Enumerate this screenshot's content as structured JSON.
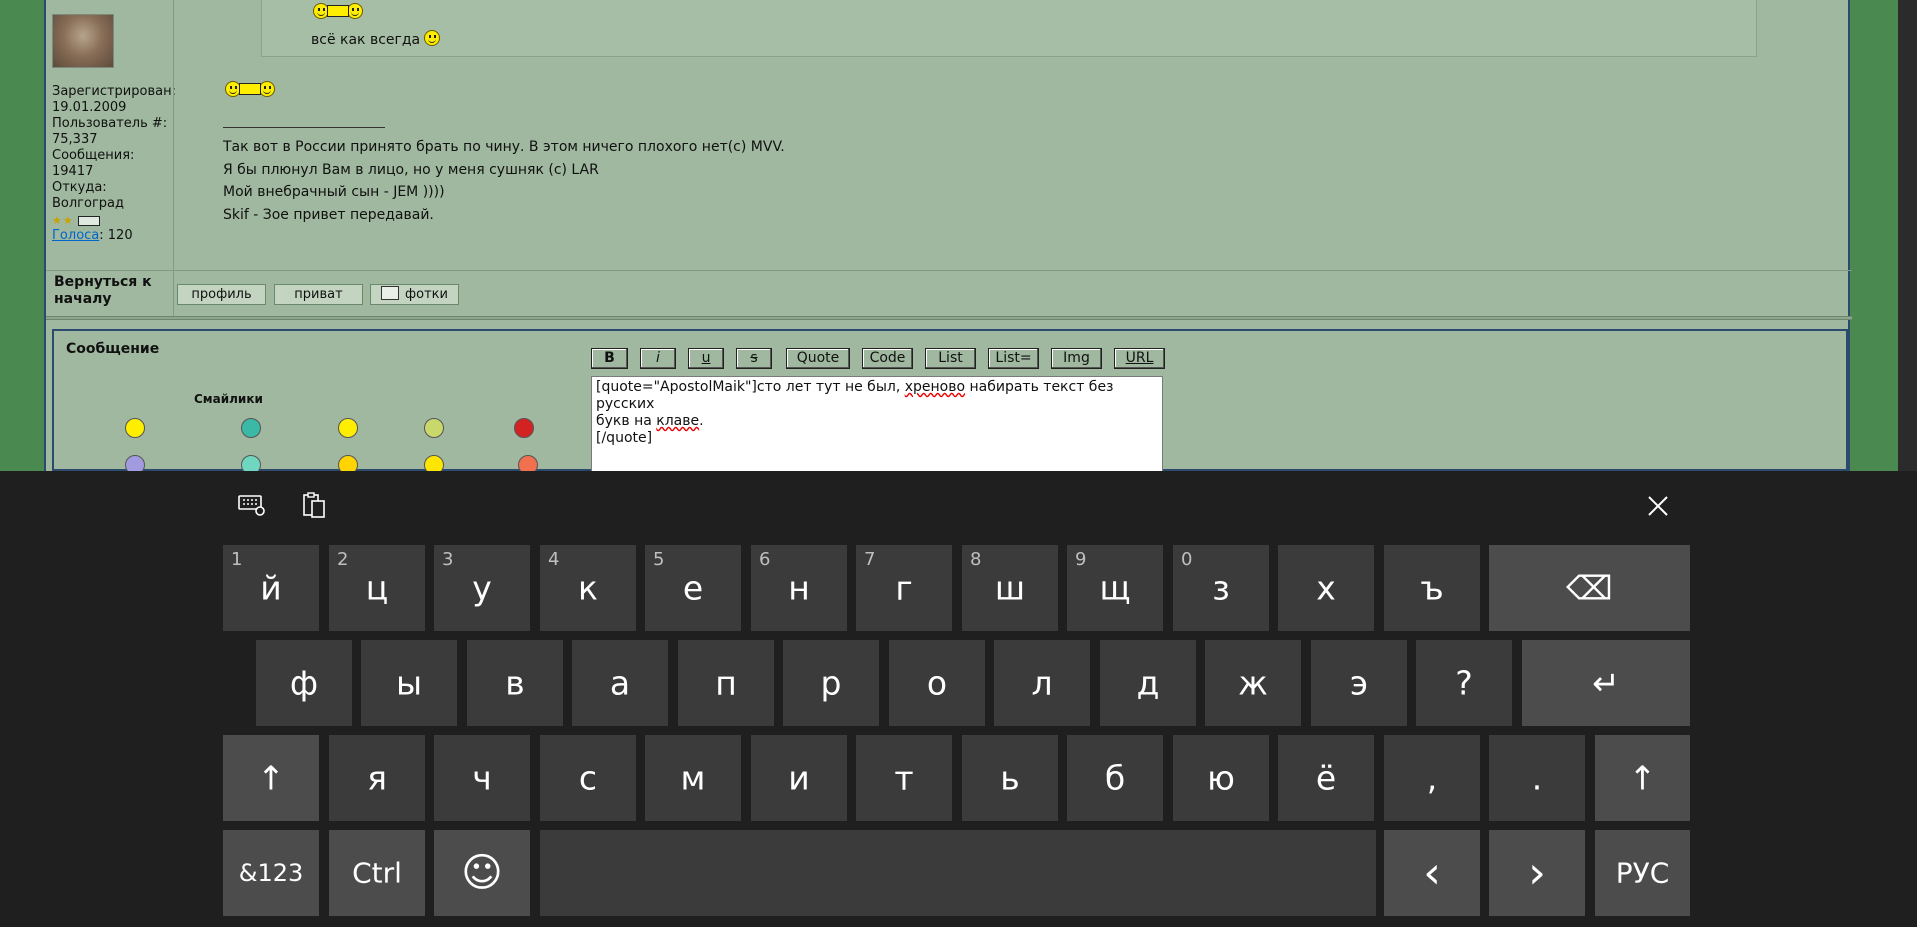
{
  "post": {
    "quote_text": "всё как всегда",
    "user": {
      "registered_label": "Зарегистрирован:",
      "registered_value": "19.01.2009",
      "user_no_label": "Пользователь #:",
      "user_no_value": "75,337",
      "messages_label": "Сообщения:",
      "messages_value": "19417",
      "from_label": "Откуда:",
      "from_value": "Волгоград",
      "votes_link": "Голоса",
      "votes_value": ": 120"
    },
    "signature": [
      "Так вот в России принято брать по чину. В этом ничего плохого нет(с) MVV.",
      "Я бы плюнул Вам в лицо, но у меня сушняк (с) LAR",
      "Мой внебрачный сын - JEM ))))",
      "Skif - Зое привет передавай."
    ],
    "back_to_top": "Вернуться к началу",
    "buttons": {
      "profile": "профиль",
      "private": "приват",
      "photos": "фотки"
    }
  },
  "editor": {
    "title": "Сообщение",
    "smilies_header": "Смайлики",
    "format_buttons": [
      "B",
      "i",
      "u",
      "s",
      "Quote",
      "Code",
      "List",
      "List=",
      "Img",
      "URL"
    ],
    "text_line1": "[quote=\"ApostolMaik\"]сто лет тут не был, ",
    "text_err1": "хреново",
    "text_line1b": " набирать текст без русских",
    "text_line2a": "букв на ",
    "text_err2": "клаве",
    "text_line2b": ".",
    "text_line3": "[/quote]"
  },
  "keyboard": {
    "toolbar": {
      "settings_icon": "keyboard-settings-icon",
      "clipboard_icon": "clipboard-icon",
      "close_icon": "close-icon"
    },
    "row1": [
      {
        "k": "й",
        "n": "1"
      },
      {
        "k": "ц",
        "n": "2"
      },
      {
        "k": "у",
        "n": "3"
      },
      {
        "k": "к",
        "n": "4"
      },
      {
        "k": "е",
        "n": "5"
      },
      {
        "k": "н",
        "n": "6"
      },
      {
        "k": "г",
        "n": "7"
      },
      {
        "k": "ш",
        "n": "8"
      },
      {
        "k": "щ",
        "n": "9"
      },
      {
        "k": "з",
        "n": "0"
      },
      {
        "k": "х",
        "n": ""
      },
      {
        "k": "ъ",
        "n": ""
      }
    ],
    "row2": [
      "ф",
      "ы",
      "в",
      "а",
      "п",
      "р",
      "о",
      "л",
      "д",
      "ж",
      "э",
      "?"
    ],
    "row3": [
      "я",
      "ч",
      "с",
      "м",
      "и",
      "т",
      "ь",
      "б",
      "ю",
      "ё",
      ",",
      "."
    ],
    "symbols_key": "&123",
    "ctrl_key": "Ctrl",
    "lang_key": "РУС",
    "glyphs": {
      "backspace": "⌫",
      "enter": "↵",
      "shift": "↑",
      "emoji": "☺",
      "left": "‹",
      "right": "›"
    }
  },
  "colors": {
    "page_bg": "#9fb89f",
    "side_rail": "#4a8a50",
    "keyboard_bg": "#1f1f1f",
    "key_bg": "#3b3b3b",
    "key_alt_bg": "#4c4c4c"
  }
}
